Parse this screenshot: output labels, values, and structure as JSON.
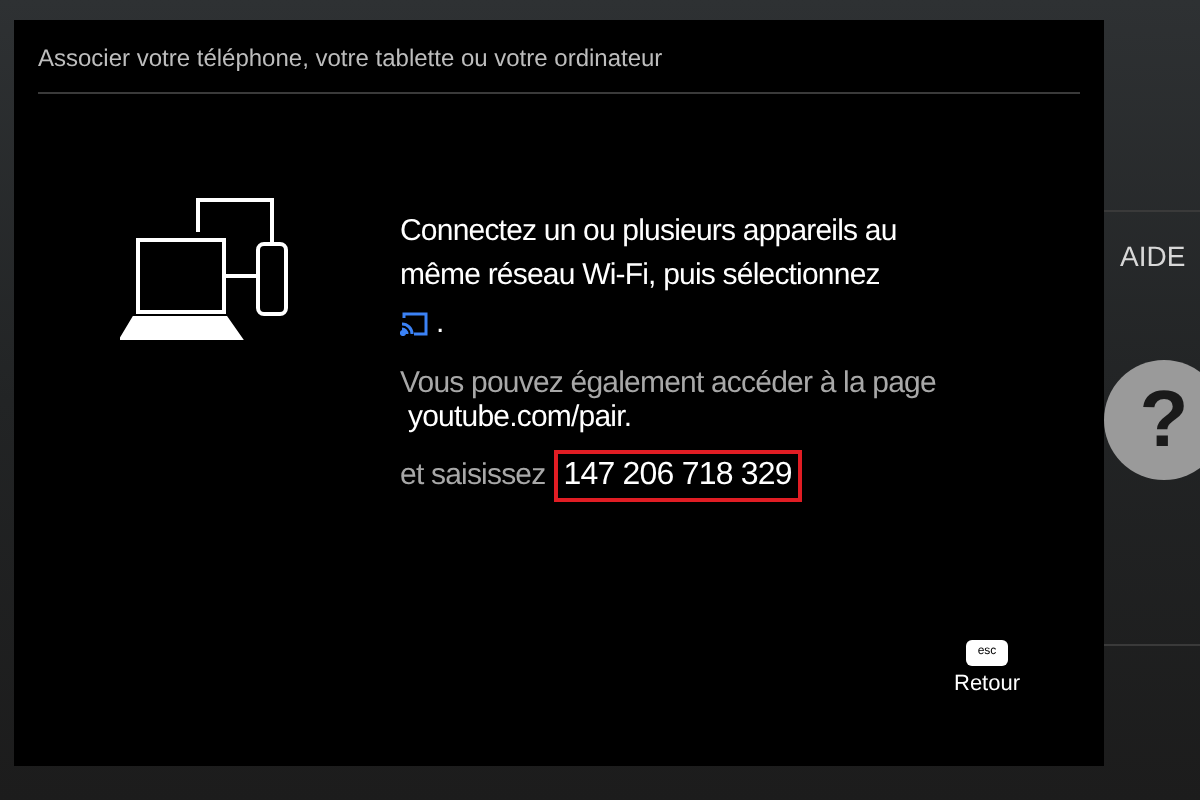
{
  "background": {
    "help_label": "AIDE",
    "help_symbol": "?"
  },
  "dialog": {
    "title": "Associer votre téléphone, votre tablette ou votre ordinateur",
    "instruction": "Connectez un ou plusieurs appareils au même réseau Wi-Fi, puis sélectionnez",
    "instruction_end": ".",
    "alternative": "Vous pouvez également accéder à la page",
    "url": "youtube.com/pair.",
    "enter_label": "et saisissez",
    "code": "147 206 718 329",
    "back_key": "esc",
    "back_label": "Retour"
  }
}
